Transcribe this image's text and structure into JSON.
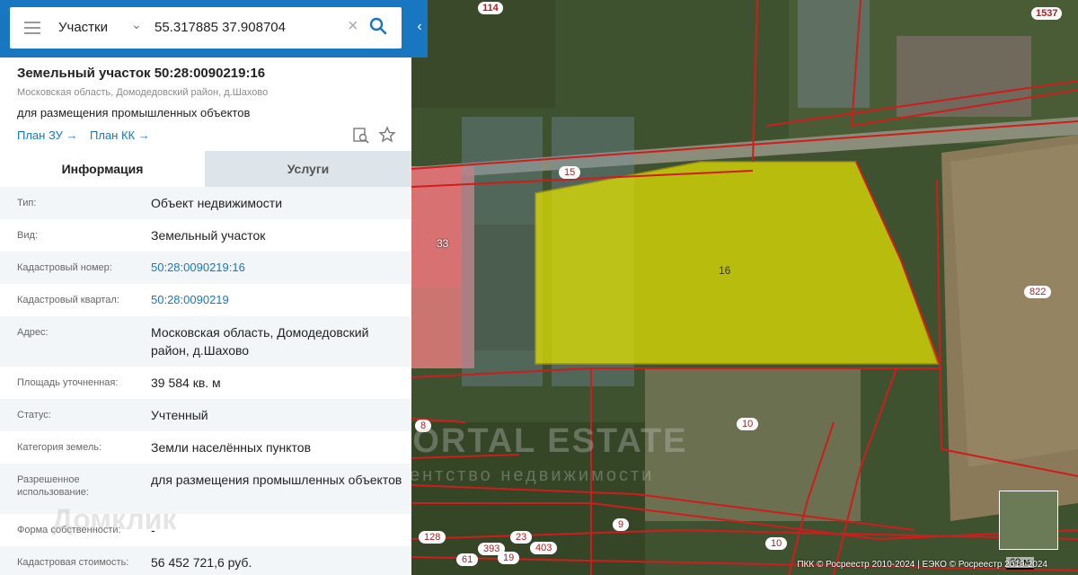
{
  "search": {
    "type": "Участки",
    "value": "55.317885 37.908704"
  },
  "parcel": {
    "title": "Земельный участок 50:28:0090219:16",
    "address_small": "Московская область, Домодедовский район, д.Шахово",
    "purpose": "для размещения промышленных объектов",
    "links": [
      "План ЗУ",
      "План КК"
    ]
  },
  "tabs": {
    "info": "Информация",
    "services": "Услуги"
  },
  "rows": [
    {
      "label": "Тип:",
      "value": "Объект недвижимости"
    },
    {
      "label": "Вид:",
      "value": "Земельный участок"
    },
    {
      "label": "Кадастровый номер:",
      "value": "50:28:0090219:16"
    },
    {
      "label": "Кадастровый квартал:",
      "value": "50:28:0090219"
    },
    {
      "label": "Адрес:",
      "value": "Московская область, Домодедовский район, д.Шахово"
    },
    {
      "label": "Площадь уточненная:",
      "value": "39 584 кв. м"
    },
    {
      "label": "Статус:",
      "value": "Учтенный"
    },
    {
      "label": "Категория земель:",
      "value": "Земли населённых пунктов"
    },
    {
      "label": "Разрешенное использование:",
      "value": "для размещения промышленных объектов"
    },
    {
      "label": "Форма собственности:",
      "value": "-"
    },
    {
      "label": "Кадастровая стоимость:",
      "value": "56 452 721,6 руб."
    }
  ],
  "map": {
    "labels": [
      "114",
      "1537",
      "15",
      "33",
      "16",
      "822",
      "8",
      "10",
      "9",
      "10",
      "128",
      "23",
      "403",
      "393",
      "19",
      "61"
    ],
    "scale": "60 м",
    "copyright": "ПКК © Росреестр 2010-2024 | ЕЭКО © Росреестр 2019-2024",
    "watermark_main": "PORTAL ESTATE",
    "watermark_sub": "агентство недвижимости",
    "watermark_domclick": "Домклик"
  },
  "colors": {
    "accent": "#1976c0",
    "parcel_fill": "#e6e600",
    "boundary": "#d01c1c"
  }
}
